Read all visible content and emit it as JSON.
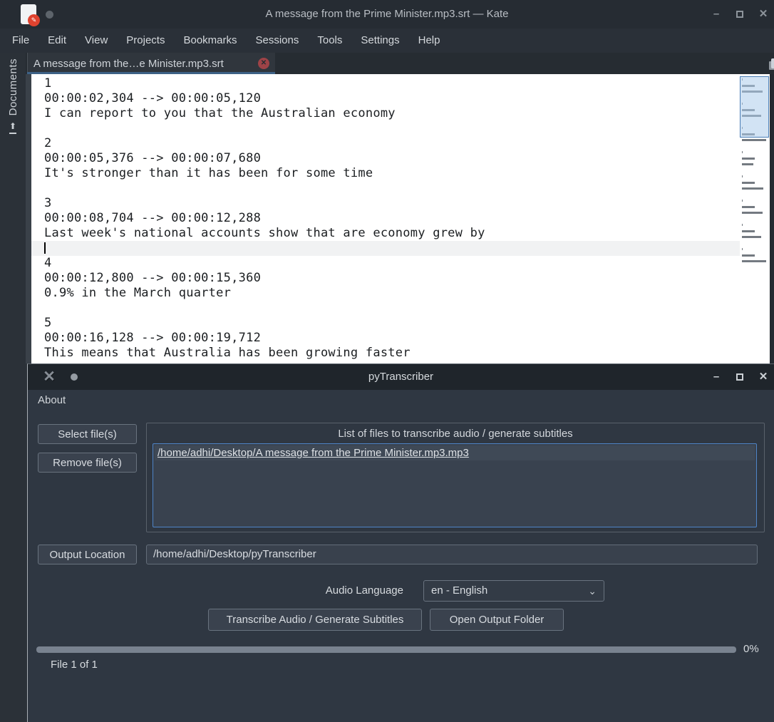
{
  "kate": {
    "titlebar": {
      "title": "A message from the Prime Minister.mp3.srt — Kate"
    },
    "menu_items": [
      "File",
      "Edit",
      "View",
      "Projects",
      "Bookmarks",
      "Sessions",
      "Tools",
      "Settings",
      "Help"
    ],
    "tab": {
      "label": "A message from the…e Minister.mp3.srt"
    },
    "sidebar": {
      "label": "Documents"
    },
    "editor": {
      "subtitles": [
        {
          "index": "1",
          "time": "00:00:02,304 --> 00:00:05,120",
          "text": "I can report to you that the Australian economy"
        },
        {
          "index": "2",
          "time": "00:00:05,376 --> 00:00:07,680",
          "text": "It's stronger than it has been for some time"
        },
        {
          "index": "3",
          "time": "00:00:08,704 --> 00:00:12,288",
          "text": "Last week's national accounts show that are economy grew by"
        },
        {
          "index": "4",
          "time": "00:00:12,800 --> 00:00:15,360",
          "text": "0.9% in the March quarter"
        },
        {
          "index": "5",
          "time": "00:00:16,128 --> 00:00:19,712",
          "text": "This means that Australia has been growing faster"
        }
      ],
      "visible_line_count": 19,
      "cursor_line_index": 11
    },
    "minimap": {
      "total_lines": 31,
      "viewport_start_line": 1,
      "viewport_end_line": 10
    }
  },
  "pytranscriber": {
    "titlebar": {
      "title": "pyTranscriber"
    },
    "menu_items": [
      "About"
    ],
    "buttons": {
      "select": "Select file(s)",
      "remove": "Remove file(s)",
      "output_location": "Output Location",
      "transcribe": "Transcribe Audio / Generate Subtitles",
      "open_output": "Open Output Folder"
    },
    "file_list": {
      "title": "List of files to transcribe audio / generate subtitles",
      "items": [
        "/home/adhi/Desktop/A message from the Prime Minister.mp3.mp3"
      ]
    },
    "output_location_value": "/home/adhi/Desktop/pyTranscriber",
    "audio_language": {
      "label": "Audio Language",
      "selected": "en - English"
    },
    "progress": {
      "percent": "0%",
      "status": "File 1 of 1"
    }
  },
  "icons": {
    "kate_app": "✎",
    "minimize": "–",
    "close": "✕",
    "tab_close": "✕",
    "pt_app": "✕",
    "chevron_down": "⌄",
    "documents_upload": "⬆"
  },
  "colors": {
    "kate_titlebar": "#262c33",
    "kate_menubar": "#2a3038",
    "tab_underline": "#3d6186",
    "editor_bg": "#ffffff",
    "editor_text": "#1b1e21",
    "current_line_bg": "#f1f2f3",
    "minimap_viewport_border": "#4a7db5",
    "pt_titlebar": "#1f252b",
    "pt_body": "#2f3742",
    "file_list_border": "#4e84c7",
    "progress_track": "#79828f"
  }
}
